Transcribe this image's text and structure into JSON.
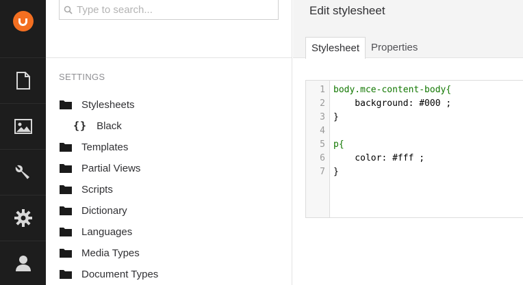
{
  "colors": {
    "brand": "#f36f21",
    "appbar": "#1d1d1d"
  },
  "appbar": {
    "sections": [
      {
        "name": "content",
        "icon": "document-icon"
      },
      {
        "name": "media",
        "icon": "image-icon"
      },
      {
        "name": "settings",
        "icon": "wrench-icon"
      },
      {
        "name": "developer",
        "icon": "gear-icon"
      },
      {
        "name": "users",
        "icon": "user-icon"
      }
    ]
  },
  "search": {
    "placeholder": "Type to search..."
  },
  "tree": {
    "section_title": "SETTINGS",
    "items": [
      {
        "label": "Stylesheets"
      },
      {
        "label": "Templates"
      },
      {
        "label": "Partial Views"
      },
      {
        "label": "Scripts"
      },
      {
        "label": "Dictionary"
      },
      {
        "label": "Languages"
      },
      {
        "label": "Media Types"
      },
      {
        "label": "Document Types"
      }
    ],
    "child": {
      "label": "Black",
      "icon": "braces-icon"
    }
  },
  "editor": {
    "title": "Edit stylesheet",
    "tabs": [
      {
        "label": "Stylesheet"
      },
      {
        "label": "Properties"
      }
    ],
    "line_numbers": [
      "1",
      "2",
      "3",
      "4",
      "5",
      "6",
      "7"
    ],
    "code_lines": [
      "body.mce-content-body{",
      "    background: #000 ;",
      "}",
      "",
      "p{",
      "    color: #fff ;",
      "}"
    ]
  }
}
